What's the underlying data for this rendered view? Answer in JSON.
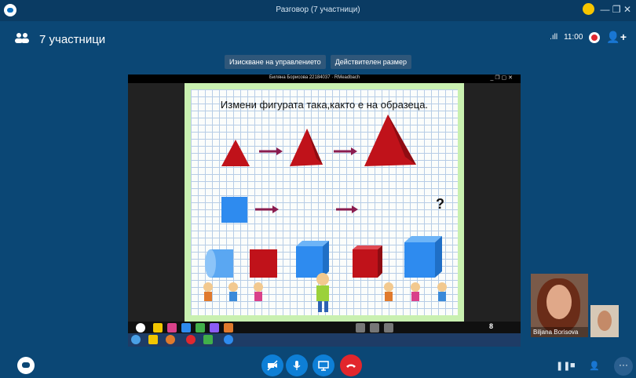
{
  "window": {
    "title": "Разговор (7 участници)",
    "controls": "— ❐ ✕"
  },
  "header": {
    "participants": "7 участници",
    "signal": ".ıll",
    "time": "11:00"
  },
  "share_buttons": [
    "Изискване на управлението",
    "Действителен размер"
  ],
  "shared": {
    "window_title": "Биляна Борисова 22184037 · RMeadbach",
    "window_controls": "_ ❐ ▢ ✕",
    "slide_title": "Измени фигурата така,както е на образеца.",
    "question_mark": "?",
    "page_number": "8"
  },
  "participant": {
    "name": "Biljana Borisova"
  },
  "colors": {
    "bg": "#0b4775",
    "red": "#c0121a",
    "blue": "#2e8bef",
    "end_call": "#e2262c"
  },
  "icons": [
    "video-off-icon",
    "microphone-icon",
    "screen-share-icon",
    "end-call-icon"
  ],
  "bottom_right": {
    "pause_label": "❚❚",
    "layout_label": "■",
    "more_label": "···"
  }
}
